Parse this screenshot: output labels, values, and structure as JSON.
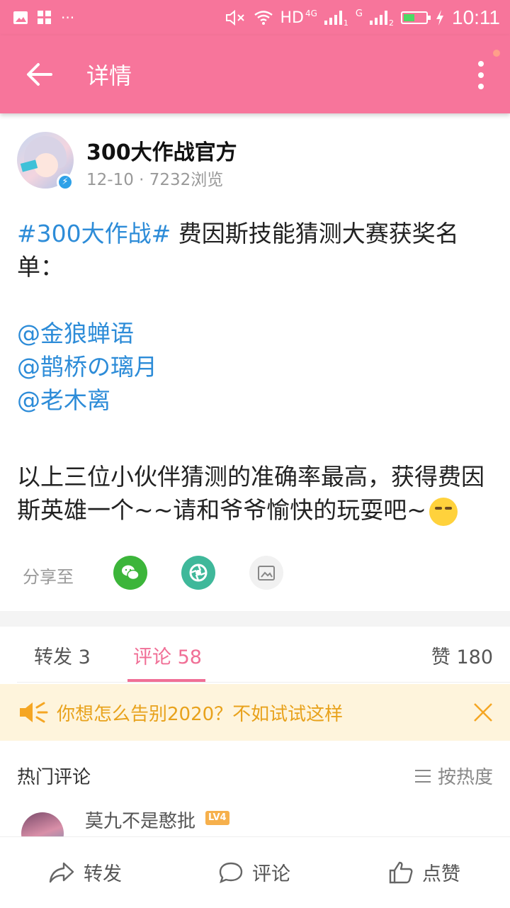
{
  "status_bar": {
    "network": "HD",
    "network_gen": "4G",
    "sim1": "1",
    "sim2_gen": "G",
    "sim2": "2",
    "time": "10:11",
    "battery_level": 0.45
  },
  "header": {
    "title": "详情"
  },
  "post": {
    "author": "300大作战官方",
    "meta": "12-10 · 7232浏览",
    "topic": "#300大作战#",
    "intro": "费因斯技能猜测大赛获奖名单：",
    "mentions": [
      "@金狼蝉语",
      "@鹊桥の璃月",
      "@老木离"
    ],
    "closing": "以上三位小伙伴猜测的准确率最高，获得费因斯英雄一个~~请和爷爷愉快的玩耍吧~"
  },
  "share": {
    "label": "分享至"
  },
  "tabs": {
    "forward": "转发 3",
    "comment": "评论 58",
    "like": "赞 180"
  },
  "notice": {
    "text": "你想怎么告别2020？不如试试这样"
  },
  "comments": {
    "title": "热门评论",
    "sort_label": "按热度",
    "first": {
      "name": "莫九不是憨批",
      "level": "LV4"
    }
  },
  "bottom_bar": {
    "forward": "转发",
    "comment": "评论",
    "like": "点赞"
  },
  "colors": {
    "brand": "#f7759b",
    "link": "#2d8cd8",
    "notice_text": "#e8a21c"
  }
}
